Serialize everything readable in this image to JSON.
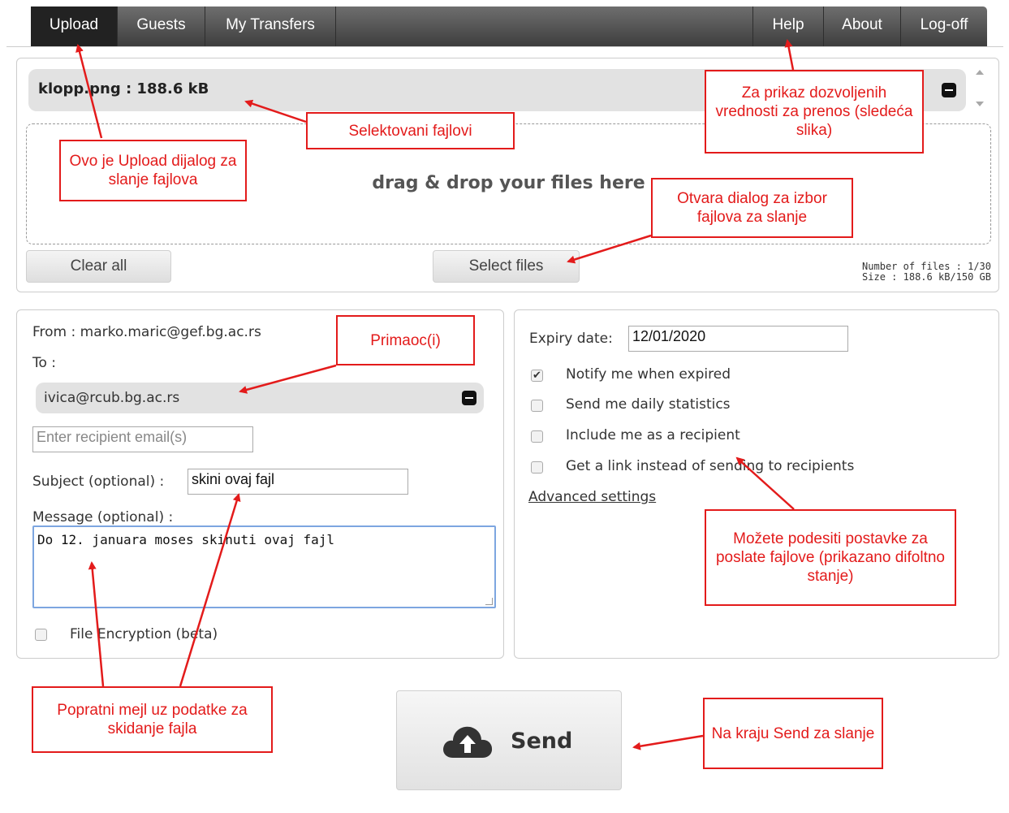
{
  "nav": {
    "upload": "Upload",
    "guests": "Guests",
    "my_transfers": "My Transfers",
    "help": "Help",
    "about": "About",
    "logoff": "Log-off"
  },
  "upload": {
    "file": "klopp.png : 188.6 kB",
    "drop_text": "drag & drop your files here",
    "clear_all": "Clear all",
    "select_files": "Select files",
    "number_of_files": "Number of files : 1/30",
    "size": "Size : 188.6 kB/150 GB"
  },
  "form": {
    "from": "From : marko.maric@gef.bg.ac.rs",
    "to_label": "To :",
    "recipient": "ivica@rcub.bg.ac.rs",
    "recipient_placeholder": "Enter recipient email(s)",
    "subject_label": "Subject (optional) :",
    "subject_value": "skini ovaj fajl",
    "message_label": "Message (optional) :",
    "message_value": "Do 12. januara moses skinuti ovaj fajl",
    "encryption_label": "File Encryption (beta)",
    "encryption_checked": false
  },
  "options": {
    "expiry_label": "Expiry date:",
    "expiry_value": "12/01/2020",
    "items": [
      {
        "label": "Notify me when expired",
        "checked": true
      },
      {
        "label": "Send me daily statistics",
        "checked": false
      },
      {
        "label": "Include me as a recipient",
        "checked": false
      },
      {
        "label": "Get a link instead of sending to recipients",
        "checked": false
      }
    ],
    "advanced": "Advanced settings"
  },
  "send": {
    "label": "Send",
    "icon": "cloud-upload-icon"
  },
  "annotations": {
    "upload_dialog": "Ovo je Upload dijalog za slanje fajlova",
    "selected_files": "Selektovani fajlovi",
    "help_note": "Za prikaz dozvoljenih vrednosti za prenos (sledeća slika)",
    "open_dialog": "Otvara dialog za izbor fajlova za slanje",
    "recipients": "Primaoc(i)",
    "settings_note": "Možete podesiti postavke za poslate fajlove (prikazano difoltno stanje)",
    "message_note": "Popratni mejl uz podatke za skidanje fajla",
    "send_note": "Na kraju Send za slanje"
  },
  "colors": {
    "annotation": "#e31b1b",
    "nav_bg": "#3e3e3e",
    "nav_active": "#222222",
    "focus_border": "#7da6e0"
  }
}
